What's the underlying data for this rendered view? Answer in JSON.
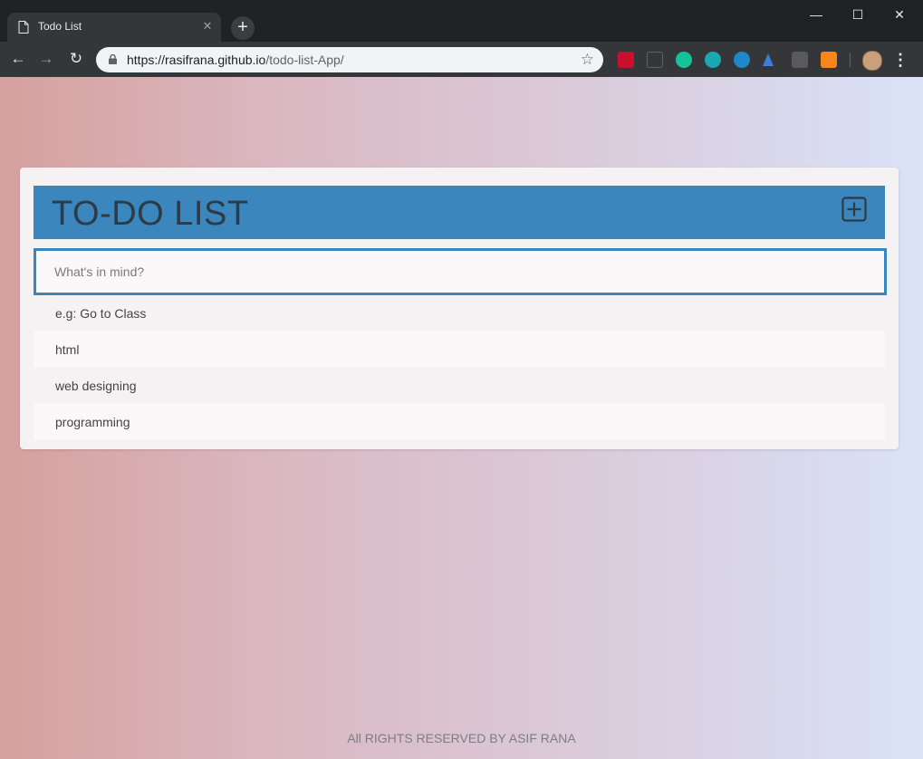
{
  "browser": {
    "tab_title": "Todo List",
    "tab_close": "✕",
    "new_tab": "+",
    "url_host": "https://rasifrana.github.io",
    "url_path": "/todo-list-App/",
    "window_controls": {
      "minimize": "—",
      "maximize": "☐",
      "close": "✕"
    },
    "nav": {
      "back": "←",
      "forward": "→",
      "reload": "↻"
    },
    "star": "☆",
    "menu": "⋮",
    "extensions": [
      {
        "name": "lastpass-icon",
        "color": "#c8102e"
      },
      {
        "name": "json-icon",
        "color": "#35363a"
      },
      {
        "name": "grammarly-icon",
        "color": "#15c39a"
      },
      {
        "name": "m-extension-icon",
        "color": "#1aa8b5"
      },
      {
        "name": "sync-icon",
        "color": "#1e88c9"
      },
      {
        "name": "ethereum-icon",
        "color": "#3b7dd8"
      },
      {
        "name": "pdf-icon",
        "color": "#5a5a5a"
      },
      {
        "name": "metamask-icon",
        "color": "#f6851b"
      }
    ]
  },
  "app": {
    "title": "TO-DO LIST",
    "input_placeholder": "What's in mind?",
    "items": [
      "e.g: Go to Class",
      "html",
      "web designing",
      "programming"
    ],
    "footer": "All RIGHTS RESERVED BY ASIF RANA"
  },
  "colors": {
    "header_bg": "#3b86bc",
    "title_text": "#2e3a45"
  }
}
